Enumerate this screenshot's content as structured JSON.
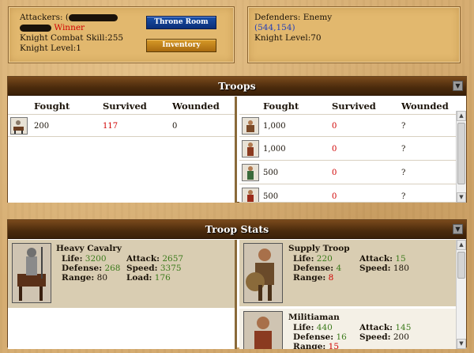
{
  "attacker": {
    "label": "Attackers: (",
    "result": "Winner",
    "combat_skill": "Knight Combat Skill:255",
    "level": "Knight Level:1"
  },
  "defender": {
    "label": "Defenders: Enemy",
    "coords": "(544,154)",
    "level": "Knight Level:70"
  },
  "buttons": {
    "throne": "Throne Room",
    "inventory": "Inventory"
  },
  "troops": {
    "title": "Troops",
    "headers": [
      "Fought",
      "Survived",
      "Wounded"
    ],
    "attacker_rows": [
      {
        "fought": "200",
        "survived": "117",
        "wounded": "0"
      }
    ],
    "defender_rows": [
      {
        "fought": "1,000",
        "survived": "0",
        "wounded": "?"
      },
      {
        "fought": "1,000",
        "survived": "0",
        "wounded": "?"
      },
      {
        "fought": "500",
        "survived": "0",
        "wounded": "?"
      },
      {
        "fought": "500",
        "survived": "0",
        "wounded": "?"
      }
    ]
  },
  "troop_stats": {
    "title": "Troop Stats",
    "heavy_cavalry": {
      "name": "Heavy Cavalry",
      "life_l": "Life:",
      "life": "3200",
      "attack_l": "Attack:",
      "attack": "2657",
      "defense_l": "Defense:",
      "defense": "268",
      "speed_l": "Speed:",
      "speed": "3375",
      "range_l": "Range:",
      "range": "80",
      "load_l": "Load:",
      "load": "176"
    },
    "supply_troop": {
      "name": "Supply Troop",
      "life_l": "Life:",
      "life": "220",
      "attack_l": "Attack:",
      "attack": "15",
      "defense_l": "Defense:",
      "defense": "4",
      "speed_l": "Speed:",
      "speed": "180",
      "range_l": "Range:",
      "range": "8"
    },
    "militiaman": {
      "name": "Militiaman",
      "life_l": "Life:",
      "life": "440",
      "attack_l": "Attack:",
      "attack": "145",
      "defense_l": "Defense:",
      "defense": "16",
      "speed_l": "Speed:",
      "speed": "200",
      "range_l": "Range:",
      "range": "15"
    }
  },
  "colors": {
    "red": "#d00000",
    "green": "#3a7a1a",
    "blue": "#2540b8"
  }
}
